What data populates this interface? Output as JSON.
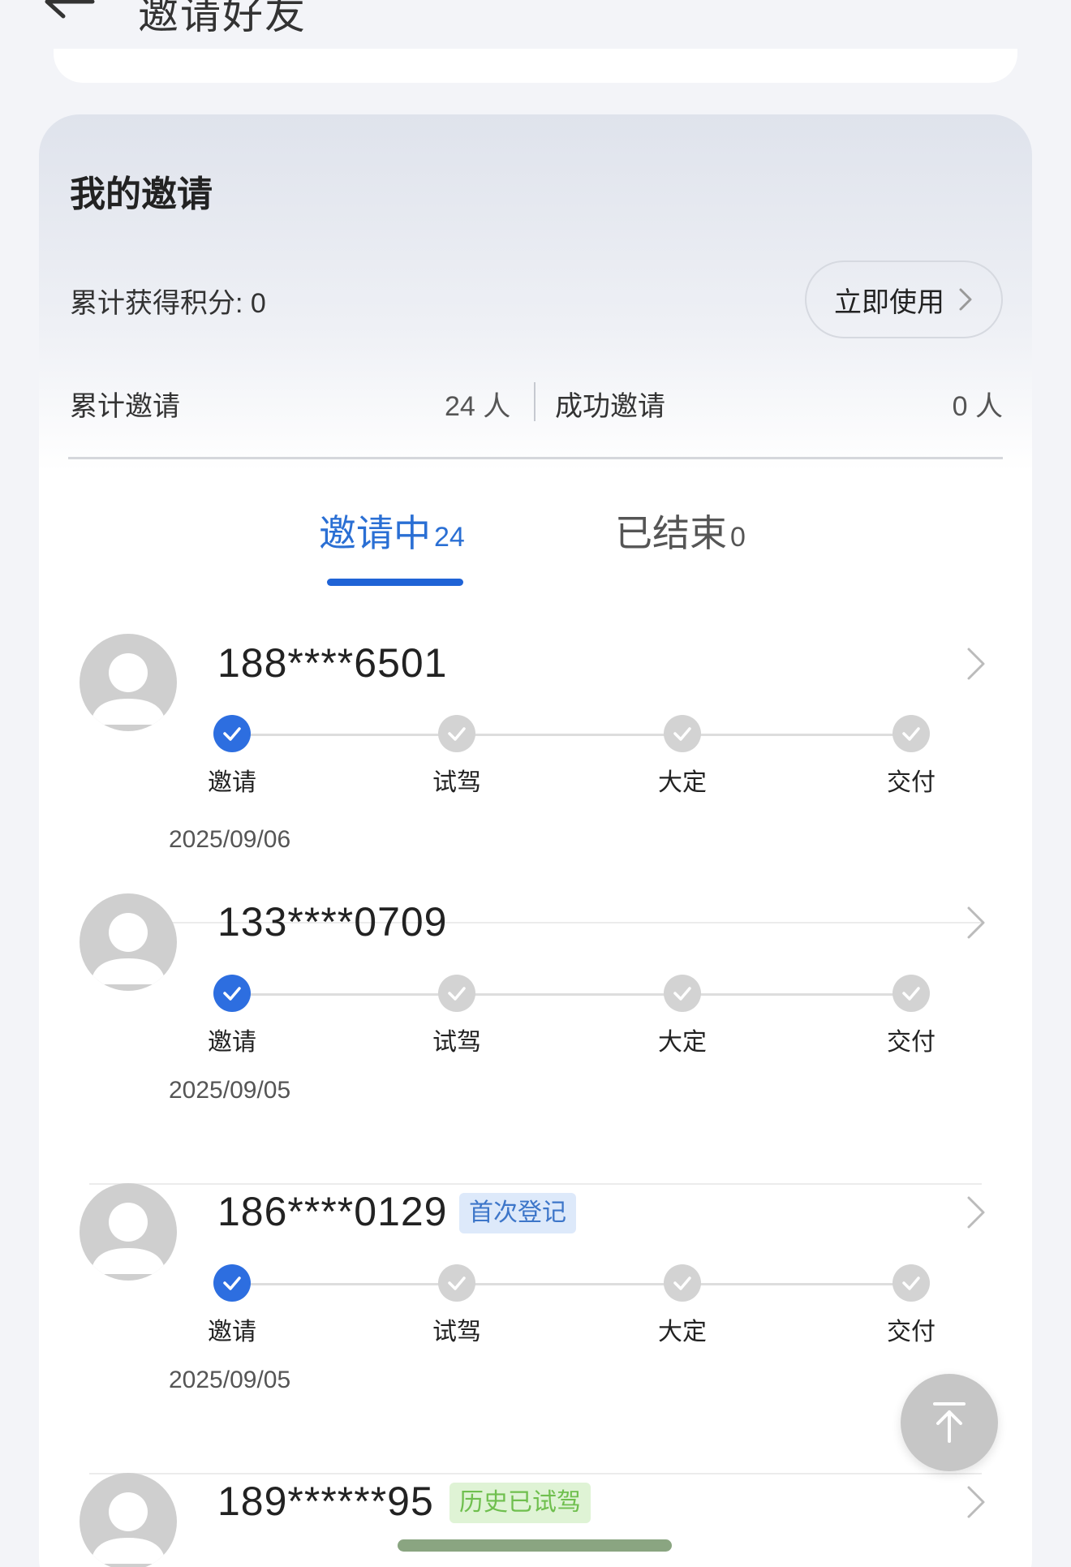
{
  "header": {
    "title": "邀请好友",
    "back_icon": "arrow-left-icon"
  },
  "my_invites": {
    "title": "我的邀请",
    "points_label": "累计获得积分:",
    "points_value": "0",
    "use_button_label": "立即使用",
    "total_invited_label": "累计邀请",
    "total_invited_value": "24 人",
    "success_invited_label": "成功邀请",
    "success_invited_value": "0 人"
  },
  "tabs": [
    {
      "label": "邀请中",
      "count": "24",
      "active": true
    },
    {
      "label": "已结束",
      "count": "0",
      "active": false
    }
  ],
  "step_labels": [
    "邀请",
    "试驾",
    "大定",
    "交付"
  ],
  "invites": [
    {
      "phone": "188****6501",
      "tag": "",
      "date": "2025/09/06",
      "completed_steps": 1
    },
    {
      "phone": "133****0709",
      "tag": "",
      "date": "2025/09/05",
      "completed_steps": 1
    },
    {
      "phone": "186****0129",
      "tag": "首次登记",
      "date": "2025/09/05",
      "completed_steps": 1
    },
    {
      "phone": "189******95",
      "tag": "历史已试驾",
      "date": "",
      "completed_steps": 1
    }
  ],
  "colors": {
    "accent": "#1f63d6",
    "step_done": "#2d6ee0",
    "step_todo": "#d3d3d3",
    "tag_blue_bg": "#dde9fa",
    "tag_green_bg": "#dff3d5"
  },
  "scroll_top_icon": "arrow-up-to-top-icon"
}
